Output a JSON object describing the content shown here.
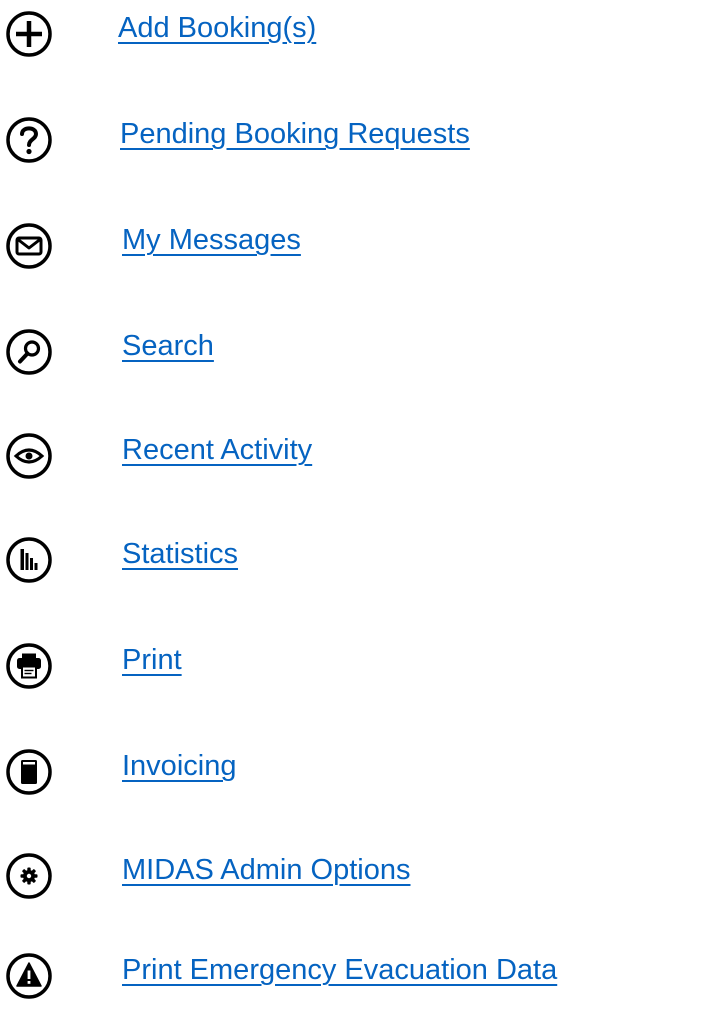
{
  "colors": {
    "link": "#0563c1",
    "icon": "#000000",
    "background": "#ffffff"
  },
  "menu": {
    "items": [
      {
        "id": "add-booking",
        "label": "Add Booking(s)",
        "icon": "plus-circle-icon"
      },
      {
        "id": "pending-booking-requests",
        "label": "Pending Booking Requests",
        "icon": "question-circle-icon"
      },
      {
        "id": "my-messages",
        "label": "My Messages",
        "icon": "envelope-circle-icon"
      },
      {
        "id": "search",
        "label": "Search",
        "icon": "magnifier-circle-icon"
      },
      {
        "id": "recent-activity",
        "label": "Recent Activity",
        "icon": "eye-circle-icon"
      },
      {
        "id": "statistics",
        "label": "Statistics",
        "icon": "bar-chart-circle-icon"
      },
      {
        "id": "print",
        "label": "Print",
        "icon": "printer-circle-icon"
      },
      {
        "id": "invoicing",
        "label": "Invoicing",
        "icon": "document-circle-icon"
      },
      {
        "id": "midas-admin-options",
        "label": "MIDAS Admin Options",
        "icon": "gear-circle-icon"
      },
      {
        "id": "print-emergency-evacuation-data",
        "label": "Print Emergency Evacuation Data",
        "icon": "warning-circle-icon"
      }
    ]
  }
}
